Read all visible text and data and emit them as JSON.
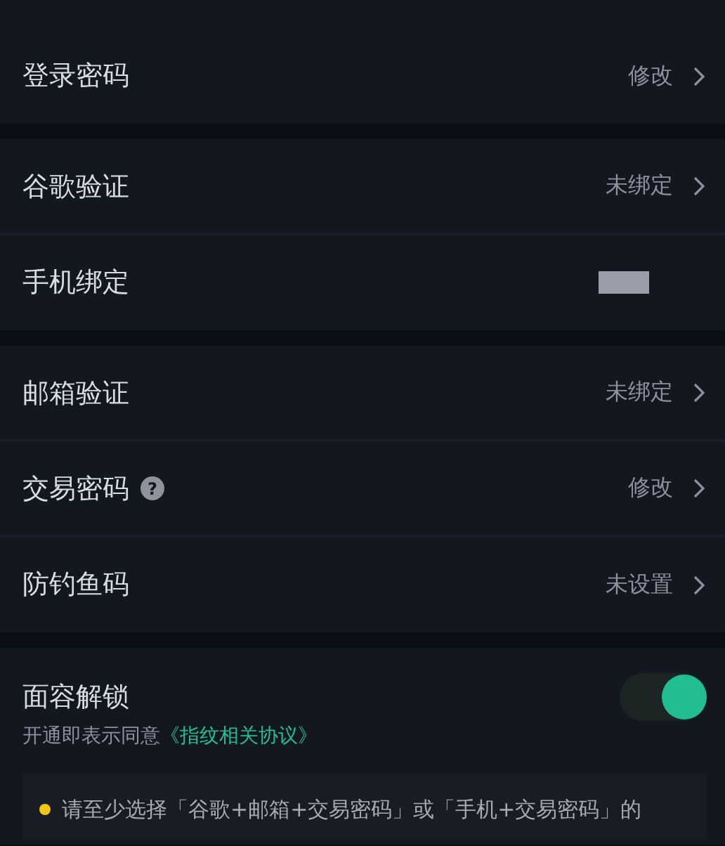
{
  "sections": [
    {
      "rows": [
        {
          "label": "登录密码",
          "kind": "value",
          "value": "修改",
          "help": null
        }
      ]
    },
    {
      "rows": [
        {
          "label": "谷歌验证",
          "kind": "value",
          "value": "未绑定",
          "help": null
        },
        {
          "label": "手机绑定",
          "kind": "redacted",
          "help": null
        }
      ]
    },
    {
      "rows": [
        {
          "label": "邮箱验证",
          "kind": "value",
          "value": "未绑定",
          "help": null
        },
        {
          "label": "交易密码",
          "kind": "value",
          "value": "修改",
          "help": "?"
        },
        {
          "label": "防钓鱼码",
          "kind": "value",
          "value": "未设置",
          "help": null
        }
      ]
    }
  ],
  "face_unlock": {
    "label": "面容解锁",
    "on": true,
    "agreement_prefix": "开通即表示同意",
    "agreement_link": "《指纹相关协议》"
  },
  "notice": {
    "text": "请至少选择「谷歌+邮箱+交易密码」或「手机+交易密码」的"
  }
}
